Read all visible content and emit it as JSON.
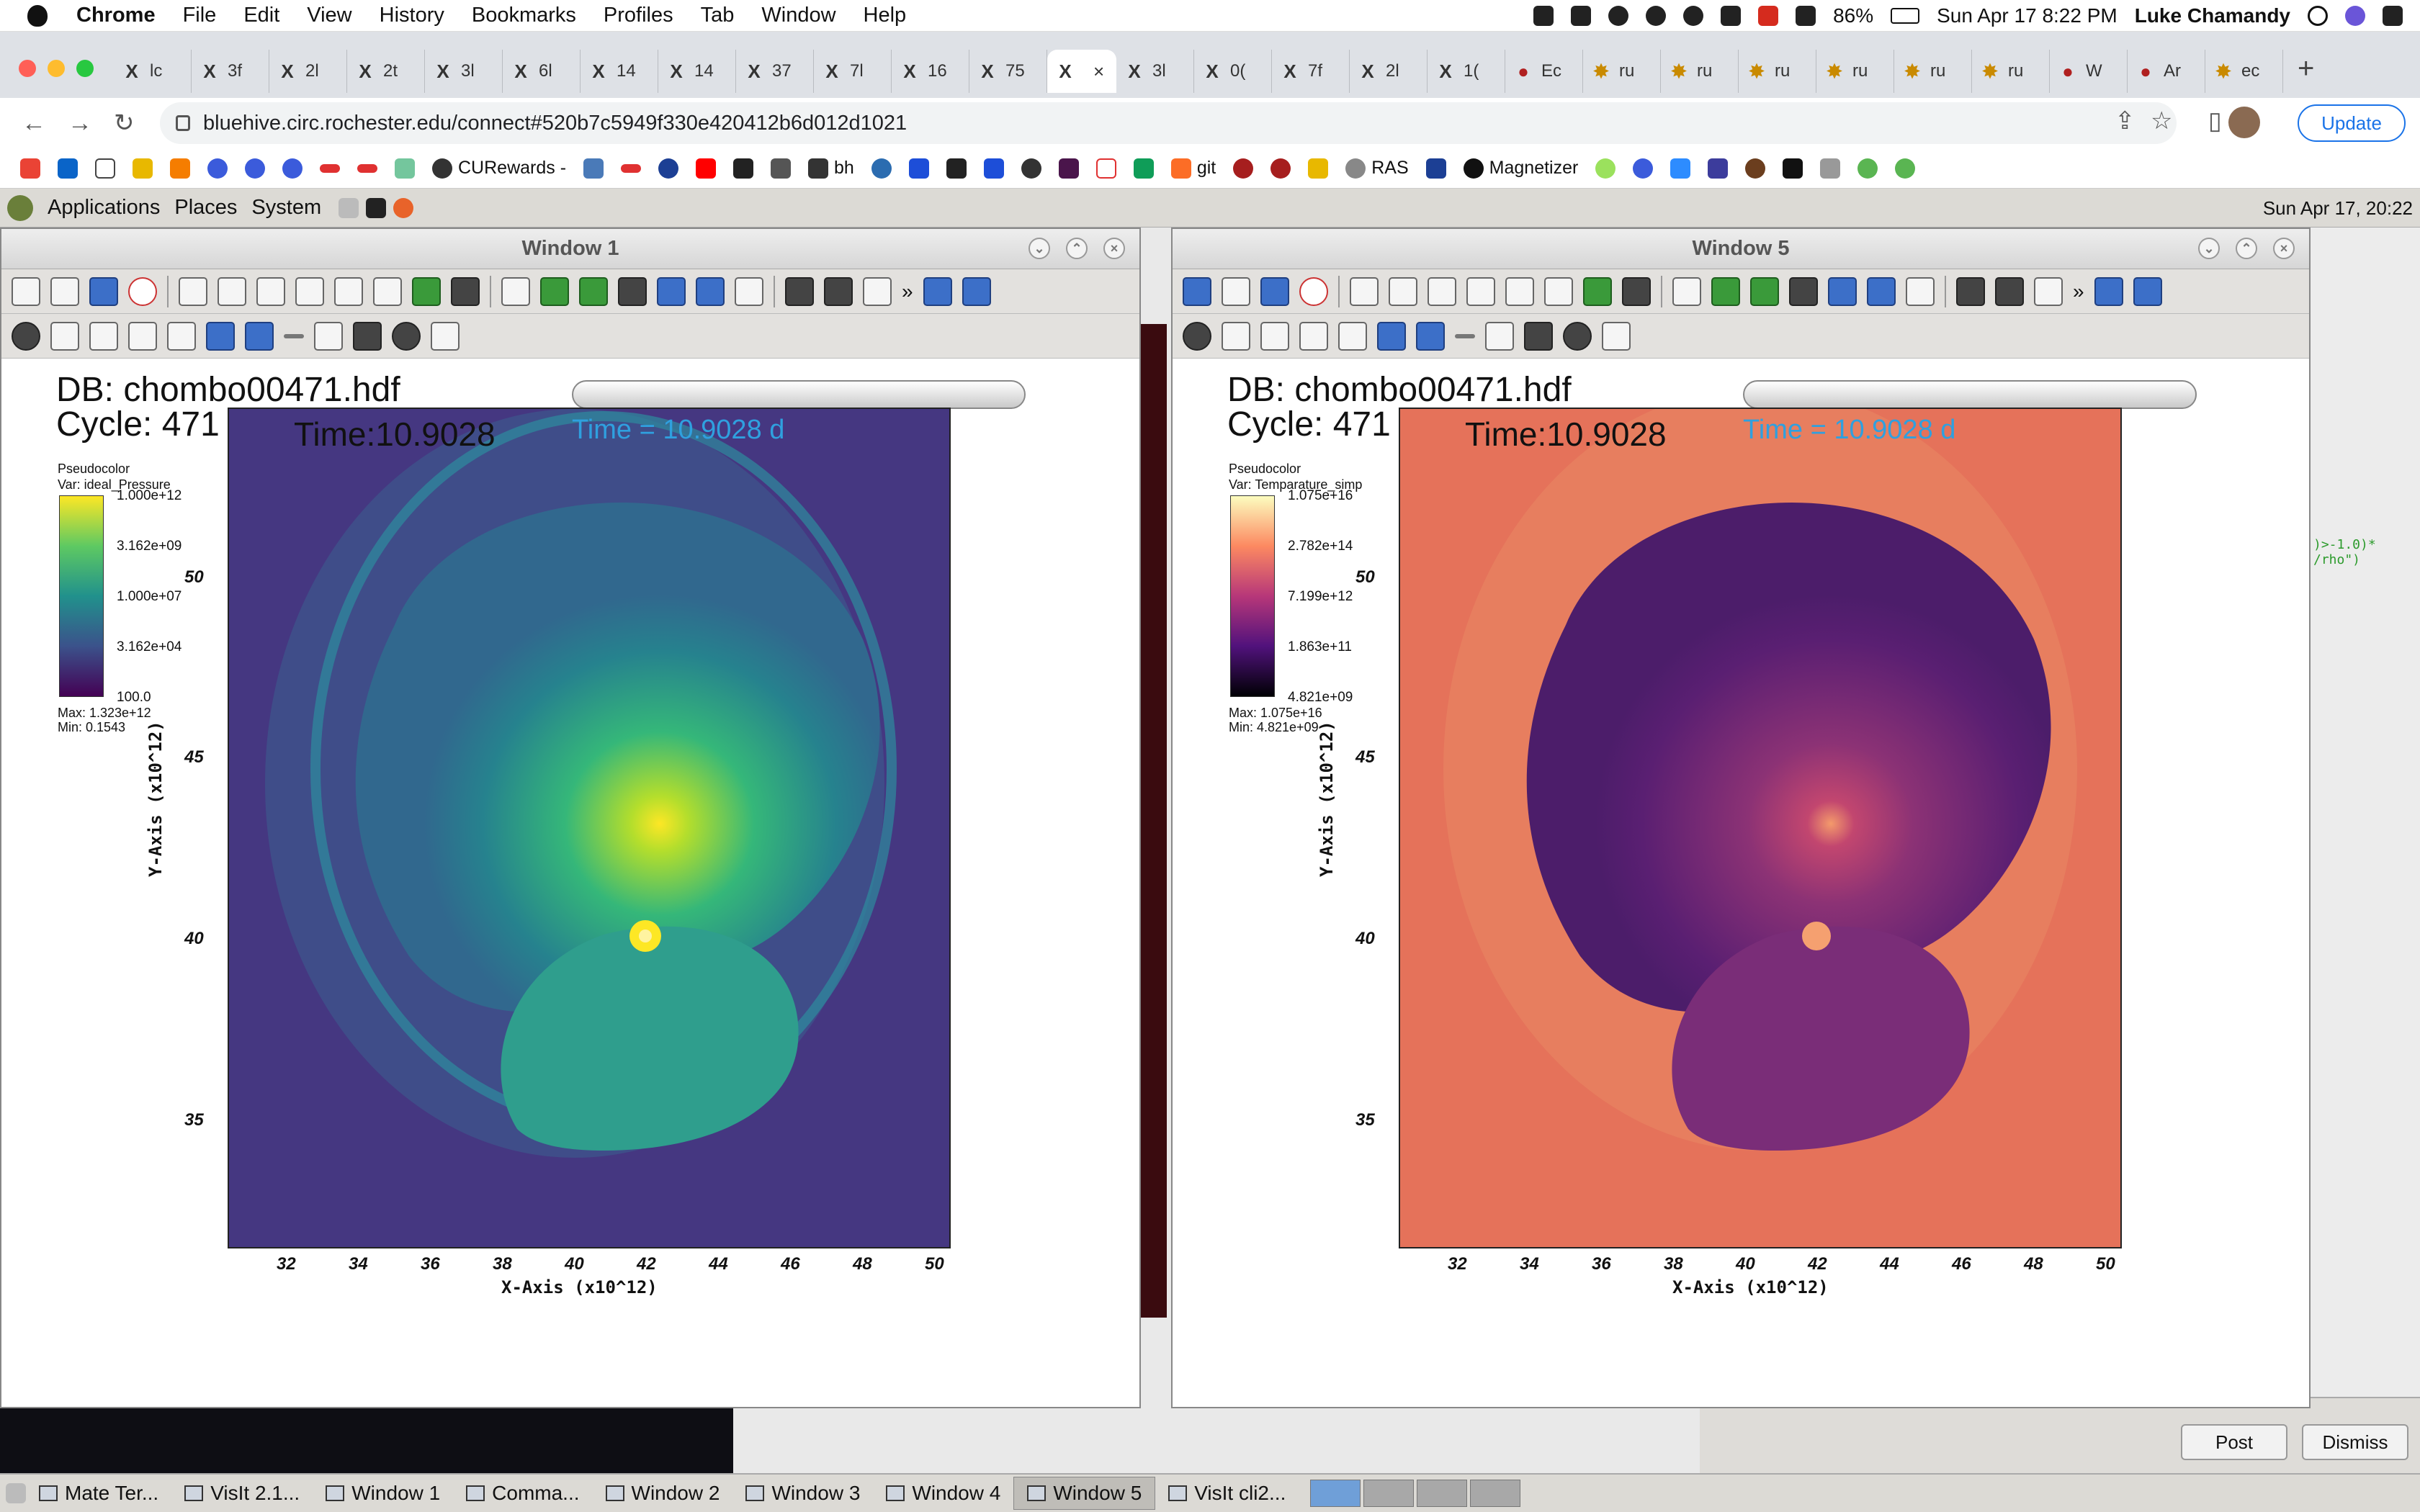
{
  "menubar": {
    "app": "Chrome",
    "menus": [
      "File",
      "Edit",
      "View",
      "History",
      "Bookmarks",
      "Profiles",
      "Tab",
      "Window",
      "Help"
    ],
    "battery": "86%",
    "datetime": "Sun Apr 17  8:22 PM",
    "user": "Luke Chamandy"
  },
  "tabs": [
    {
      "icon": "X",
      "label": "lc"
    },
    {
      "icon": "X",
      "label": "3f"
    },
    {
      "icon": "X",
      "label": "2l"
    },
    {
      "icon": "X",
      "label": "2t"
    },
    {
      "icon": "X",
      "label": "3l"
    },
    {
      "icon": "X",
      "label": "6l"
    },
    {
      "icon": "X",
      "label": "14"
    },
    {
      "icon": "X",
      "label": "14"
    },
    {
      "icon": "X",
      "label": "37"
    },
    {
      "icon": "X",
      "label": "7l"
    },
    {
      "icon": "X",
      "label": "16"
    },
    {
      "icon": "X",
      "label": "75"
    },
    {
      "icon": "X",
      "label": "",
      "active": true
    },
    {
      "icon": "X",
      "label": "3l"
    },
    {
      "icon": "X",
      "label": "0("
    },
    {
      "icon": "X",
      "label": "7f"
    },
    {
      "icon": "X",
      "label": "2l"
    },
    {
      "icon": "X",
      "label": "1("
    },
    {
      "icon": "●",
      "label": "Ec"
    },
    {
      "icon": "✸",
      "label": "ru"
    },
    {
      "icon": "✸",
      "label": "ru"
    },
    {
      "icon": "✸",
      "label": "ru"
    },
    {
      "icon": "✸",
      "label": "ru"
    },
    {
      "icon": "✸",
      "label": "ru"
    },
    {
      "icon": "✸",
      "label": "ru"
    },
    {
      "icon": "●",
      "label": "W"
    },
    {
      "icon": "●",
      "label": "Ar"
    },
    {
      "icon": "✸",
      "label": "ec"
    }
  ],
  "address": {
    "url": "bluehive.circ.rochester.edu/connect#520b7c5949f330e420412b6d012d1021",
    "update_label": "Update"
  },
  "bookmarks": [
    "CURewards -",
    "bh",
    "git",
    "RAS",
    "Magnetizer"
  ],
  "gnome": {
    "menus": [
      "Applications",
      "Places",
      "System"
    ],
    "clock": "Sun Apr 17, 20:22"
  },
  "windows": [
    {
      "title": "Window 1",
      "db": "DB: chombo00471.hdf",
      "cycle": "Cycle: 471",
      "time": "Time:10.9028",
      "annotation": "Time = 10.9028 d",
      "legend": {
        "plot": "Pseudocolor",
        "var": "Var: ideal_Pressure",
        "ticks": [
          "1.000e+12",
          "3.162e+09",
          "1.000e+07",
          "3.162e+04",
          "100.0"
        ],
        "max": "Max:  1.323e+12",
        "min": "Min:  0.1543"
      },
      "xlabel": "X-Axis  (x10^12)",
      "ylabel": "Y-Axis  (x10^12)",
      "xticks": [
        "32",
        "34",
        "36",
        "38",
        "40",
        "42",
        "44",
        "46",
        "48",
        "50"
      ],
      "yticks": [
        "50",
        "45",
        "40",
        "35"
      ],
      "colors": {
        "bg": "#453781",
        "mid": "#2a8d8c",
        "bright": "#dde318",
        "core": "#fde725"
      }
    },
    {
      "title": "Window 5",
      "db": "DB: chombo00471.hdf",
      "cycle": "Cycle: 471",
      "time": "Time:10.9028",
      "annotation": "Time = 10.9028 d",
      "legend": {
        "plot": "Pseudocolor",
        "var": "Var: Temparature_simp",
        "ticks": [
          "1.075e+16",
          "2.782e+14",
          "7.199e+12",
          "1.863e+11",
          "4.821e+09"
        ],
        "max": "Max:  1.075e+16",
        "min": "Min:  4.821e+09"
      },
      "xlabel": "X-Axis  (x10^12)",
      "ylabel": "Y-Axis  (x10^12)",
      "xticks": [
        "32",
        "34",
        "36",
        "38",
        "40",
        "42",
        "44",
        "46",
        "48",
        "50"
      ],
      "yticks": [
        "50",
        "45",
        "40",
        "35"
      ],
      "colors": {
        "bg": "#e5725a",
        "mid": "#8c3275",
        "bright": "#4c1d6a",
        "core": "#f49a6b"
      }
    }
  ],
  "dialog": {
    "post": "Post",
    "dismiss": "Dismiss"
  },
  "bg_code": [
    ")>-1.0)*",
    "/rho\")"
  ],
  "taskbar": [
    "Mate Ter...",
    "VisIt 2.1...",
    "Window 1",
    "Comma...",
    "Window 2",
    "Window 3",
    "Window 4",
    "Window 5",
    "VisIt cli2..."
  ]
}
